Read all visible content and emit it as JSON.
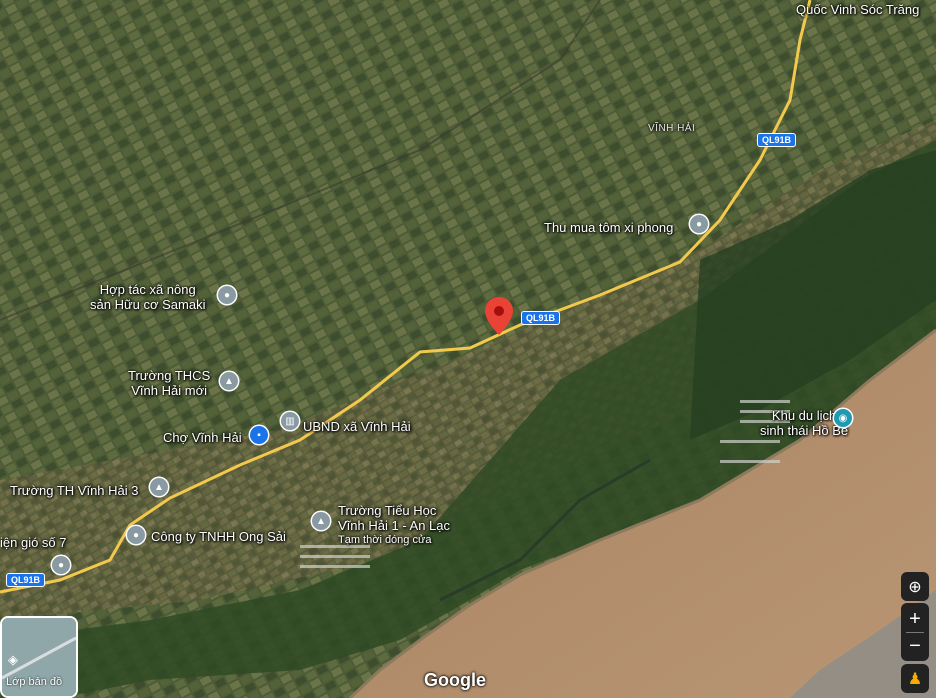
{
  "labels": {
    "top_right": "Quốc Vinh Sóc Trăng",
    "vinh_hai": "VĨNH HẢI",
    "thu_mua": "Thu mua tôm xi phong",
    "hop_tac_1": "Hợp tác xã nông",
    "hop_tac_2": "sản Hữu cơ Samaki",
    "truong_thcs_1": "Trường THCS",
    "truong_thcs_2": "Vĩnh Hải mới",
    "cho": "Chợ Vĩnh Hải",
    "ubnd": "UBND xã Vĩnh Hải",
    "truong_th": "Trường TH Vĩnh Hải 3",
    "truong_tieu_hoc_1": "Trường Tiểu Học",
    "truong_tieu_hoc_2": "Vĩnh Hải 1 - An Lạc",
    "truong_tieu_hoc_status": "Tạm thời đóng cửa",
    "cong_ty": "Công ty TNHH Ong Sải",
    "dien_gio": "iện gió số 7",
    "khu_du_lich_1": "Khu du lịch",
    "khu_du_lich_2": "sinh thái Hồ Bể"
  },
  "road_shields": {
    "ql91b_top": "QL91B",
    "ql91b_center": "QL91B",
    "ql91b_left": "QL91B"
  },
  "icons": {
    "location_pin": "location-pin",
    "school": "school-cap",
    "shopping": "shopping-cart",
    "government": "government-building",
    "camera": "camera",
    "my_location": "my-location",
    "zoom_in": "+",
    "zoom_out": "−",
    "pegman": "pegman",
    "layers": "layers"
  },
  "controls": {
    "layers_label": "Lớp bản đồ",
    "zoom_in": "+",
    "zoom_out": "−"
  },
  "branding": {
    "logo": "Google"
  },
  "colors": {
    "road": "#f2c94c",
    "sea": "#b08a68",
    "marker": "#ea4335",
    "accent": "#1a73e8"
  }
}
